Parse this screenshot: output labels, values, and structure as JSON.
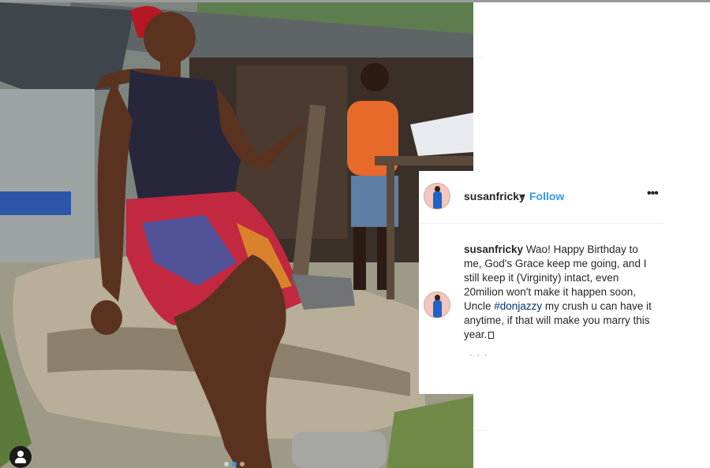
{
  "post": {
    "username": "susanfricky",
    "separator": "•",
    "follow_label": "Follow",
    "more_icon": "more-horizontal-icon",
    "more_glyph": "•••",
    "caption": {
      "username": "susanfricky",
      "text_before_hashtag": "Wao! Happy Birthday to me, God's Grace keep me going, and I still keep it (Virginity) intact, even 20milion won't make it happen soon, Uncle",
      "hashtag": "#donjazzy",
      "text_after_hashtag": "my crush u can have it anytime, if that will make you marry this year."
    },
    "loading_ellipsis": "· · ·"
  },
  "photo": {
    "user_tag_icon": "person-icon",
    "carousel": {
      "count": 3,
      "active_index": 1
    }
  },
  "colors": {
    "link_blue": "#3897f0",
    "hashtag": "#003569",
    "text": "#262626",
    "border": "#efefef"
  }
}
